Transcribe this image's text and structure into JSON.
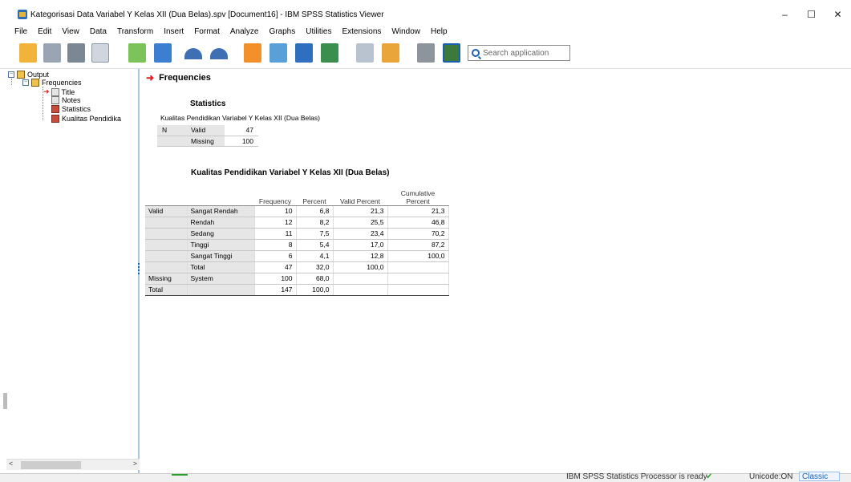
{
  "window": {
    "title": "Kategorisasi Data Variabel Y Kelas XII (Dua Belas).spv [Document16] - IBM SPSS Statistics Viewer",
    "controls": [
      "–",
      "☐",
      "✕"
    ]
  },
  "menu": [
    "File",
    "Edit",
    "View",
    "Data",
    "Transform",
    "Insert",
    "Format",
    "Analyze",
    "Graphs",
    "Utilities",
    "Extensions",
    "Window",
    "Help"
  ],
  "toolbar": {
    "search_placeholder": "Search application",
    "icons": [
      "open-folder-icon",
      "save-icon",
      "print-icon",
      "print-preview-icon",
      "export-icon",
      "recall-dialog-icon",
      "undo-icon",
      "redo-icon",
      "goto-data-icon",
      "goto-case-icon",
      "goto-variable-icon",
      "variables-icon",
      "create-title-icon",
      "insert-output-icon",
      "designate-window-icon",
      "add-icon"
    ]
  },
  "outline": {
    "root": "Output",
    "frequencies": "Frequencies",
    "children": [
      "Title",
      "Notes",
      "Statistics",
      "Kualitas Pendidika"
    ]
  },
  "content": {
    "heading": "Frequencies",
    "statistics": {
      "title": "Statistics",
      "caption": "Kualitas Pendidikan Variabel Y Kelas XII (Dua Belas)",
      "rows": [
        {
          "group": "N",
          "label": "Valid",
          "value": "47"
        },
        {
          "group": "",
          "label": "Missing",
          "value": "100"
        }
      ]
    },
    "frequency_table": {
      "title": "Kualitas Pendidikan Variabel Y Kelas XII (Dua Belas)",
      "headers": [
        "Frequency",
        "Percent",
        "Valid Percent",
        "Cumulative Percent"
      ],
      "header_cum_line1": "Cumulative",
      "header_cum_line2": "Percent",
      "rows": [
        {
          "group": "Valid",
          "label": "Sangat Rendah",
          "freq": "10",
          "pct": "6,8",
          "valid": "21,3",
          "cum": "21,3"
        },
        {
          "group": "",
          "label": "Rendah",
          "freq": "12",
          "pct": "8,2",
          "valid": "25,5",
          "cum": "46,8"
        },
        {
          "group": "",
          "label": "Sedang",
          "freq": "11",
          "pct": "7,5",
          "valid": "23,4",
          "cum": "70,2"
        },
        {
          "group": "",
          "label": "Tinggi",
          "freq": "8",
          "pct": "5,4",
          "valid": "17,0",
          "cum": "87,2"
        },
        {
          "group": "",
          "label": "Sangat Tinggi",
          "freq": "6",
          "pct": "4,1",
          "valid": "12,8",
          "cum": "100,0"
        },
        {
          "group": "",
          "label": "Total",
          "freq": "47",
          "pct": "32,0",
          "valid": "100,0",
          "cum": ""
        },
        {
          "group": "Missing",
          "label": "System",
          "freq": "100",
          "pct": "68,0",
          "valid": "",
          "cum": ""
        },
        {
          "group": "Total",
          "label": "",
          "freq": "147",
          "pct": "100,0",
          "valid": "",
          "cum": ""
        }
      ]
    }
  },
  "status": {
    "processor": "IBM SPSS Statistics Processor is ready",
    "unicode": "Unicode:ON",
    "mode": "Classic"
  },
  "colors": {
    "accent": "#1b5fb0",
    "arrow": "#e02020",
    "cell_gray": "#e6e6e6"
  }
}
